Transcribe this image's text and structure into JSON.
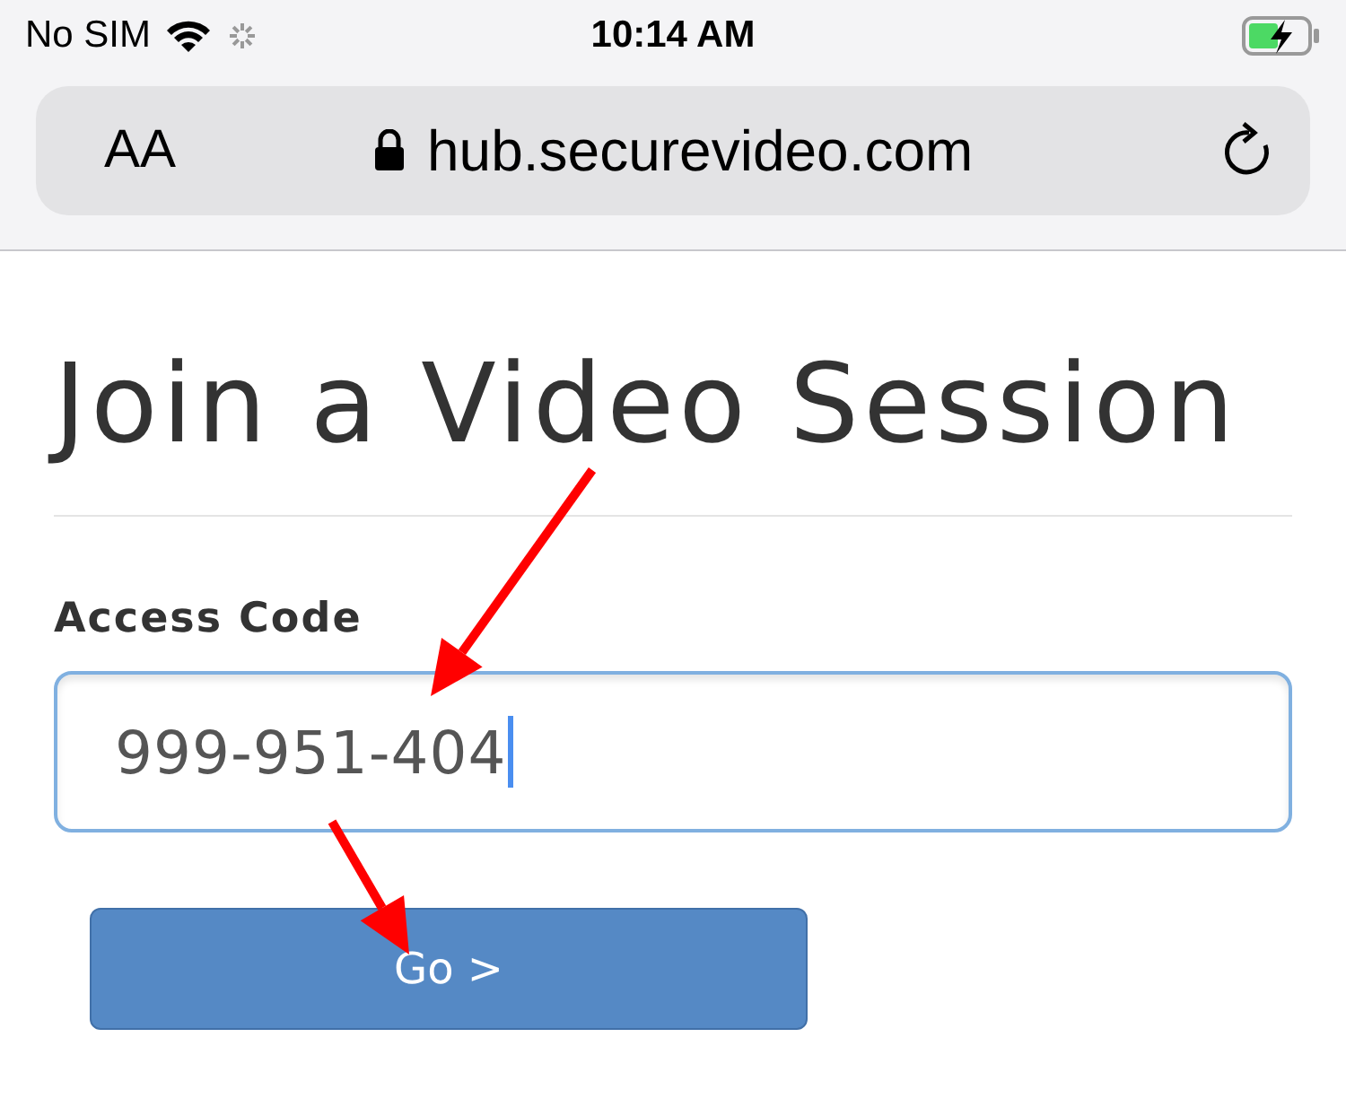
{
  "status_bar": {
    "carrier": "No SIM",
    "time": "10:14 AM",
    "charging": true
  },
  "browser": {
    "text_size": "AA",
    "url": "hub.securevideo.com",
    "secure": true
  },
  "page": {
    "title": "Join a Video Session",
    "field_label": "Access Code",
    "field_value": "999-951-404",
    "focused": true,
    "button": "Go >"
  },
  "annotations": [
    {
      "kind": "arrow"
    },
    {
      "kind": "arrow"
    }
  ]
}
